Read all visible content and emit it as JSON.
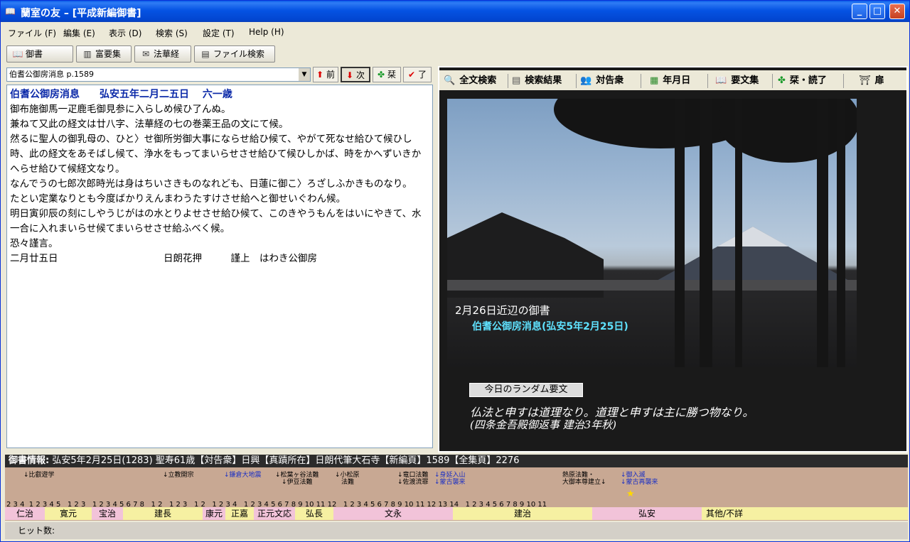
{
  "window": {
    "title": "蘭室の友 – [平成新編御書]",
    "icon": "book-icon"
  },
  "menu": [
    "ファイル (F)",
    "編集 (E)",
    "表示 (D)",
    "検索 (S)",
    "設定 (T)",
    "Help (H)"
  ],
  "toolbar": {
    "gosho": "御書",
    "fuyo": "富要集",
    "hokekyo": "法華経",
    "filesearch": "ファイル検索"
  },
  "left": {
    "combo_value": "伯耆公御房消息 p.1589",
    "prev": "前",
    "next": "次",
    "shiori": "栞",
    "ryo": "了",
    "heading": "伯耆公御房消息　　弘安五年二月二五日　 六一歳",
    "body": [
      "御布施御馬一疋鹿毛御見参に入らしめ候ひ了んぬ。",
      "兼ねて又此の経文は廿八字、法華経の七の巻薬王品の文にて候。",
      "然るに聖人の御乳母の、ひと〉せ御所労御大事にならせ給ひ候て、やがて死なせ給ひて候ひし時、此の経文をあそばし候て、浄水をもってまいらせさせ給ひて候ひしかば、時をかへずいきかへらせ給ひて候経文なり。",
      "なんでうの七郎次郎時光は身はちいさきものなれども、日蓮に御こ〉ろざしふかきものなり。",
      "たとい定業なりとも今度ばかりえんまわうたすけさせ給へと御せいぐわん候。",
      "明日寅卯辰の刻にしやうじがはの水とりよせさせ給ひ候て、このきやうもんをはいにやきて、水一合に入れまいらせ候てまいらせさせ給ふべく候。",
      "恐々謹言。",
      "二月廿五日　　　　　　　　　　　日朗花押　　　謹上　はわき公御房"
    ]
  },
  "right": {
    "tabs": [
      "全文検索",
      "検索結果",
      "対告衆",
      "年月日",
      "要文集",
      "栞・読了",
      "扉"
    ],
    "caption1": "2月26日近辺の御書",
    "caption2": "伯耆公御房消息(弘安5年2月25日)",
    "random_label": "今日のランダム要文",
    "quote_line1": "仏法と申すは道理なり。道理と申すは主に勝つ物なり。",
    "quote_line2": "(四条金吾殿御返事 建治3年秋)"
  },
  "info": {
    "label": "御書情報:",
    "text": " 弘安5年2月25日(1283) 聖寿61歳【対告衆】日興【真蹟所在】日朗代筆大石寺【新編頁】1589【全集頁】2276"
  },
  "timeline": {
    "events": {
      "e1": "↓比叡遊学",
      "e2": "↓立教開宗",
      "e3": "↓鎌倉大地震",
      "e4": "↓松葉ヶ谷法難\n　↓伊豆法難",
      "e5": "↓小松原\n　法難",
      "e6": "↓竜口法難\n↓佐渡流罪",
      "e7": "↓身延入山\n↓蒙古襲来",
      "e8": "熱原法難・\n大御本尊建立↓",
      "e9": "↓御入滅\n↓蒙古再襲来"
    },
    "eras": [
      "仁治",
      "寛元",
      "宝治",
      "建長",
      "康元",
      "正嘉",
      "正元文応",
      "弘長",
      "文永",
      "建治",
      "弘安",
      "其他/不詳"
    ]
  },
  "hit": {
    "label": "ヒット数:"
  }
}
